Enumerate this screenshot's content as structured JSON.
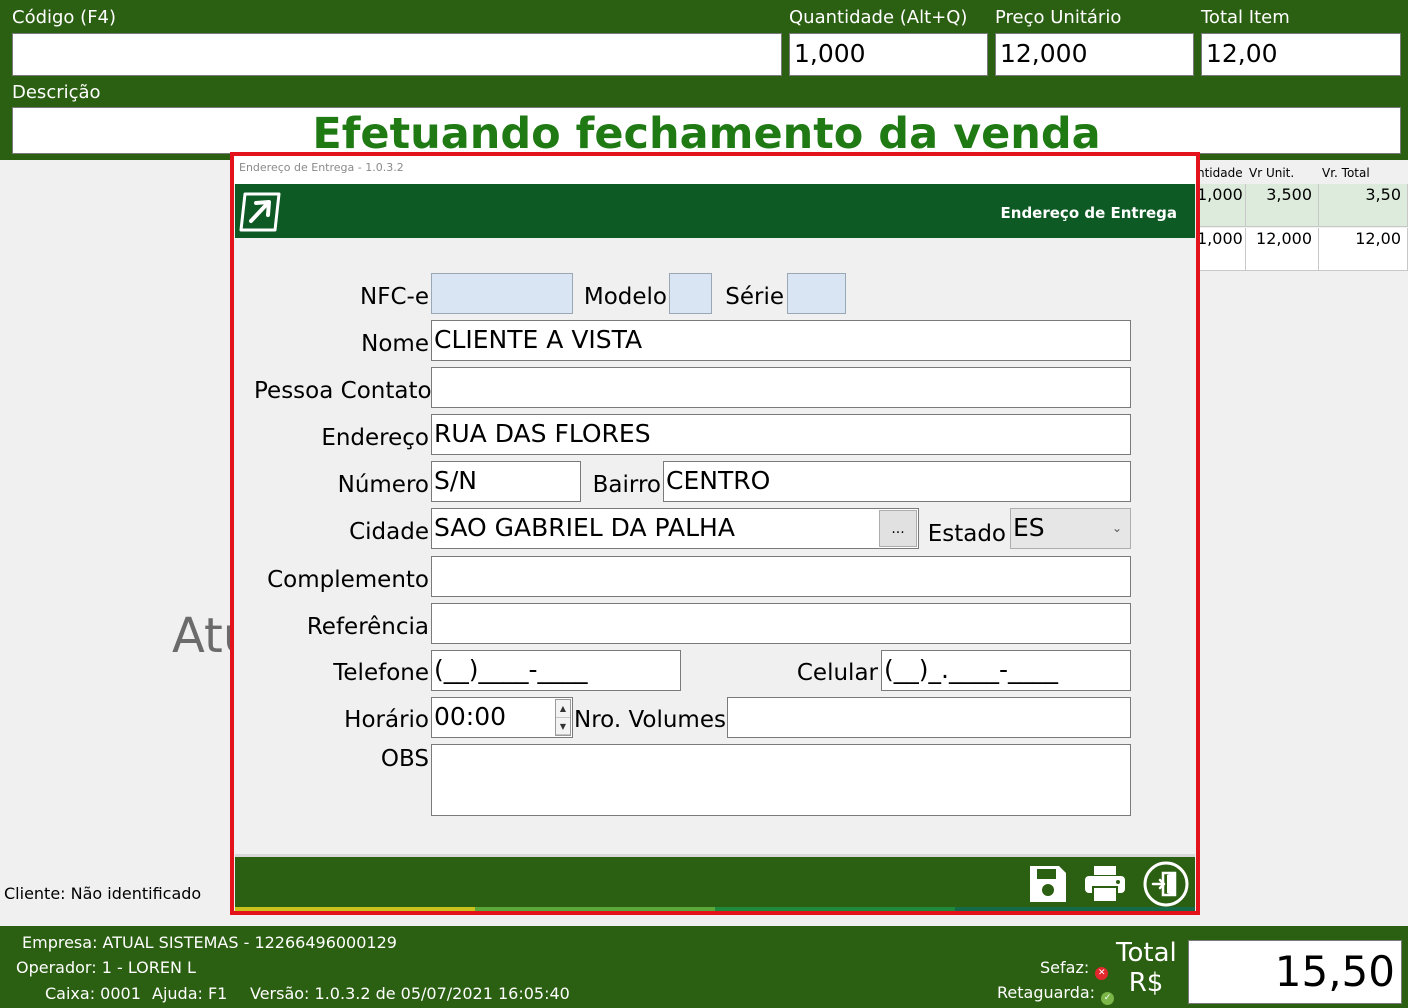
{
  "header": {
    "codigo_label": "Código (F4)",
    "codigo_value": "",
    "quantidade_label": "Quantidade (Alt+Q)",
    "quantidade_value": "1,000",
    "preco_label": "Preço Unitário",
    "preco_value": "12,000",
    "total_item_label": "Total Item",
    "total_item_value": "12,00",
    "descricao_label": "Descrição",
    "banner_text": "Efetuando fechamento da venda"
  },
  "items_grid": {
    "columns": [
      "ntidade",
      "Vr Unit.",
      "Vr. Total"
    ],
    "rows": [
      [
        "1,000",
        "3,500",
        "3,50"
      ],
      [
        "1,000",
        "12,000",
        "12,00"
      ]
    ]
  },
  "background": {
    "partial_text": "Atu",
    "cliente": "Cliente: Não identificado"
  },
  "footer": {
    "empresa": "Empresa: ATUAL SISTEMAS - 12266496000129",
    "operador": "Operador: 1 - LOREN L",
    "caixa": "Caixa: 0001",
    "ajuda": "Ajuda: F1",
    "versao": "Versão: 1.0.3.2  de 05/07/2021 16:05:40",
    "sefaz_label": "Sefaz:",
    "retaguarda_label": "Retaguarda:",
    "total_label_1": "Total",
    "total_label_2": "R$",
    "total_value": "15,50",
    "colors": {
      "sefaz": "#e0282d",
      "retaguarda": "#7ab648"
    }
  },
  "dialog": {
    "window_title": "Endereço de Entrega - 1.0.3.2",
    "header_title": "Endereço de Entrega",
    "fields": {
      "nfce_label": "NFC-e",
      "nfce_value": "",
      "modelo_label": "Modelo",
      "modelo_value": "",
      "serie_label": "Série",
      "serie_value": "",
      "nome_label": "Nome",
      "nome_value": "CLIENTE A VISTA",
      "pessoa_contato_label": "Pessoa Contato",
      "pessoa_contato_value": "",
      "endereco_label": "Endereço",
      "endereco_value": "RUA DAS FLORES",
      "numero_label": "Número",
      "numero_value": "S/N",
      "bairro_label": "Bairro",
      "bairro_value": "CENTRO",
      "cidade_label": "Cidade",
      "cidade_value": "SAO GABRIEL DA PALHA",
      "cidade_button": "...",
      "estado_label": "Estado",
      "estado_value": "ES",
      "complemento_label": "Complemento",
      "complemento_value": "",
      "referencia_label": "Referência",
      "referencia_value": "",
      "telefone_label": "Telefone",
      "telefone_value": "(__)____-____",
      "celular_label": "Celular",
      "celular_value": "(__)_.____-____",
      "horario_label": "Horário",
      "horario_value": "00:00",
      "volumes_label": "Nro. Volumes",
      "volumes_value": "",
      "obs_label": "OBS",
      "obs_value": ""
    },
    "buttons": [
      "save-icon",
      "print-icon",
      "exit-icon"
    ],
    "colors": {
      "border": "#e4131b",
      "header": "#0e5a24",
      "footer": "#2b5f12"
    }
  }
}
